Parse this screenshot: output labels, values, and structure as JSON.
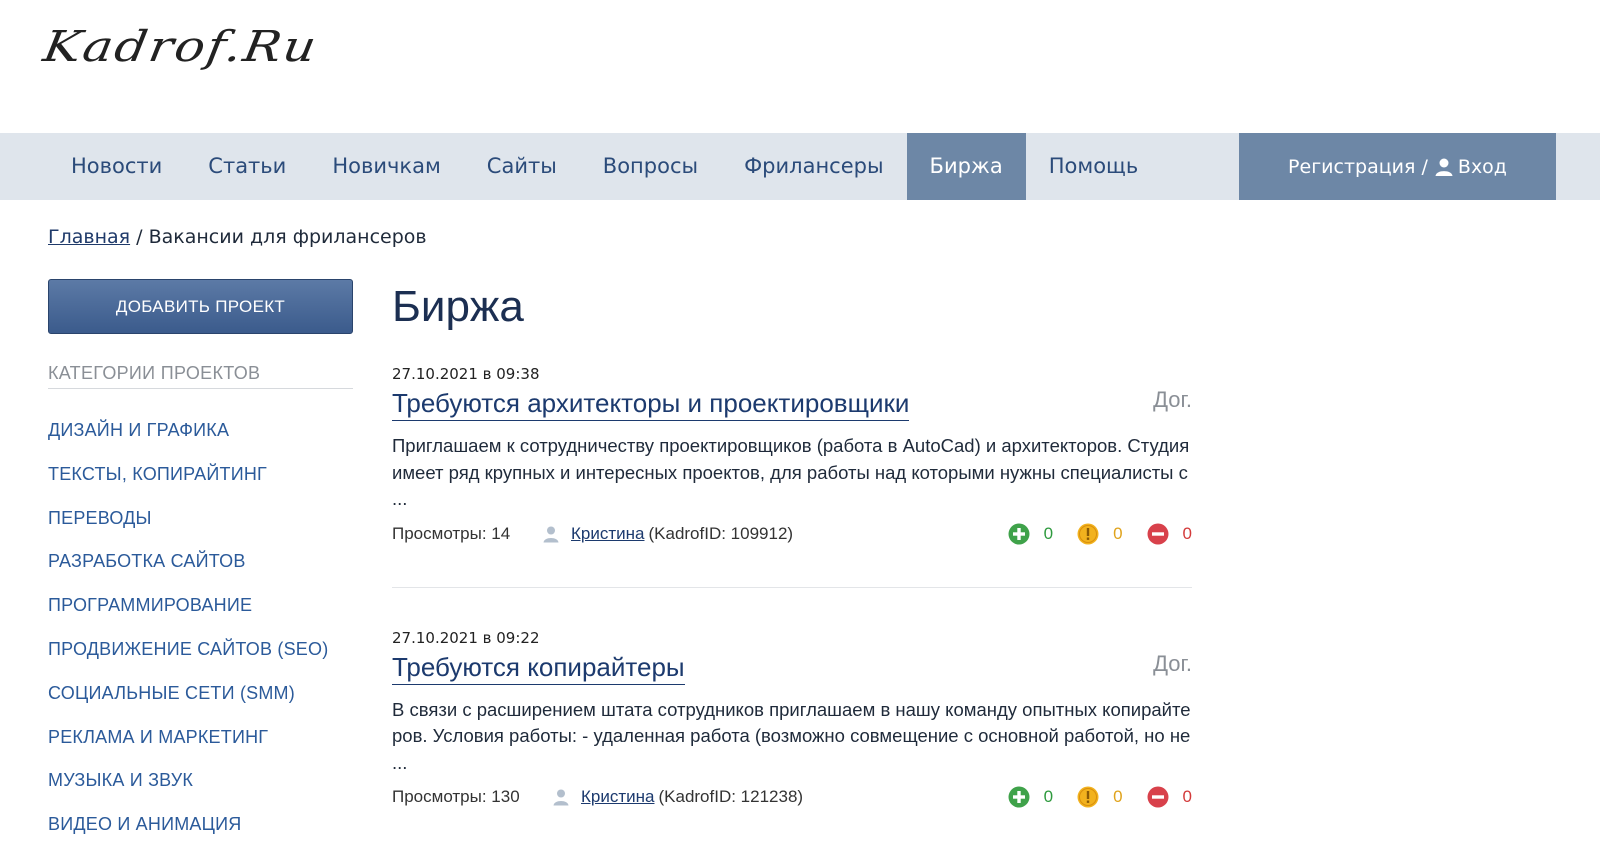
{
  "header": {
    "logo_text": "Kadrof.Ru"
  },
  "nav": {
    "items": [
      {
        "label": "Новости",
        "active": false
      },
      {
        "label": "Статьи",
        "active": false
      },
      {
        "label": "Новичкам",
        "active": false
      },
      {
        "label": "Сайты",
        "active": false
      },
      {
        "label": "Вопросы",
        "active": false
      },
      {
        "label": "Фрилансеры",
        "active": false
      },
      {
        "label": "Биржа",
        "active": true
      },
      {
        "label": "Помощь",
        "active": false
      }
    ],
    "register_label": "Регистрация /",
    "login_label": "Вход"
  },
  "breadcrumb": {
    "home": "Главная",
    "separator": " / ",
    "current": "Вакансии для фрилансеров"
  },
  "sidebar": {
    "add_button": "ДОБАВИТЬ ПРОЕКТ",
    "categories_title": "КАТЕГОРИИ ПРОЕКТОВ",
    "categories": [
      "ДИЗАЙН И ГРАФИКА",
      "ТЕКСТЫ, КОПИРАЙТИНГ",
      "ПЕРЕВОДЫ",
      "РАЗРАБОТКА САЙТОВ",
      "ПРОГРАММИРОВАНИЕ",
      "ПРОДВИЖЕНИЕ САЙТОВ (SEO)",
      "СОЦИАЛЬНЫЕ СЕТИ (SMM)",
      "РЕКЛАМА И МАРКЕТИНГ",
      "МУЗЫКА И ЗВУК",
      "ВИДЕО И АНИМАЦИЯ"
    ]
  },
  "main": {
    "title": "Биржа",
    "projects": [
      {
        "date": "27.10.2021 в 09:38",
        "title": "Требуются архитекторы и проектировщики",
        "price": "Дог.",
        "description": "Приглашаем к сотрудничеству проектировщиков (работа в AutoCad) и архитекторов. Студия имеет ряд крупных и интересных проектов, для работы над которыми нужны специалисты с ...",
        "views": "Просмотры: 14",
        "author": "Кристина",
        "author_id": "(KadrofID: 109912)",
        "votes_plus": "0",
        "votes_neutral": "0",
        "votes_minus": "0"
      },
      {
        "date": "27.10.2021 в 09:22",
        "title": "Требуются копирайтеры",
        "price": "Дог.",
        "description": "В связи с расширением штата сотрудников приглашаем в нашу команду опытных копирайтеров. Условия работы: - удаленная работа (возможно совмещение с основной работой, но не ...",
        "views": "Просмотры: 130",
        "author": "Кристина",
        "author_id": "(KadrofID: 121238)",
        "votes_plus": "0",
        "votes_neutral": "0",
        "votes_minus": "0"
      }
    ]
  },
  "colors": {
    "nav_bg": "#dfe5ec",
    "nav_active": "#6d87a6",
    "link": "#2b5a9a",
    "vote_plus": "#2e9a3e",
    "vote_neutral": "#e0a31c",
    "vote_minus": "#d33a3a"
  }
}
